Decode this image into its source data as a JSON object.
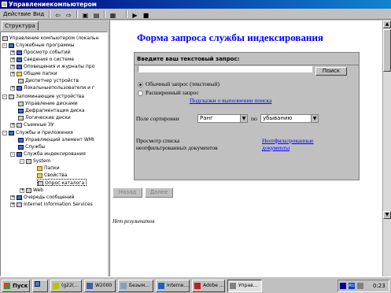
{
  "window": {
    "title": "Управлениекомпьютером"
  },
  "menu": {
    "action": "Действие",
    "view": "Вид"
  },
  "tab": {
    "structure": "Структура"
  },
  "tree": {
    "root": "Управление компьютером (локальн",
    "system_programs": "Служебные программы",
    "event_viewer": "Просмотр событий",
    "system_info": "Сведения о системе",
    "performance": "Оповещения и журналы про",
    "shared_folders": "Общие папки",
    "device_manager": "Диспетчер устройств",
    "local_users": "Локальныепользователи и г",
    "storage": "Запоминающие устройства",
    "disk_management": "Управление дисками",
    "defrag": "Дефрагментация диска",
    "logical_drives": "Логические диски",
    "removable": "Съемные ЗУ",
    "services_apps": "Службы и приложения",
    "wmi": "Управляющий элемент WMI",
    "services": "Службы",
    "indexing": "Служба индексирования",
    "system": "System",
    "directories": "Папки",
    "properties": "Свойства",
    "query": "Опрос каталога",
    "web": "Web",
    "message_queue": "Очередь сообщений",
    "iis": "Internet Information Services"
  },
  "form": {
    "title": "Форма запроса службы индексирования",
    "prompt": "Введите ваш текстовый запрос:",
    "search_button": "Поиск",
    "radio_simple": "Обычный запрос (текстовый)",
    "radio_advanced": "Расширенный запрос",
    "tips_link": "Подсказки о выполнении поиска",
    "sort_label": "Поле сортировки",
    "sort_field": "Ранг",
    "sort_by": "по",
    "sort_order": "убыванию",
    "unfiltered_label_1": "Просмотр списка",
    "unfiltered_label_2": "неотфильтрованных документов",
    "unfiltered_link_1": "Неотфильтрованные",
    "unfiltered_link_2": "документы",
    "back_button": "Назад",
    "next_button": "Далее",
    "no_results": "Нет результатов"
  },
  "taskbar": {
    "start": "Пуск",
    "items": [
      "(g22(...",
      "W2000",
      "Безым...",
      "Interne...",
      "Adobe ...",
      "Управ..."
    ],
    "clock": "0:23"
  }
}
